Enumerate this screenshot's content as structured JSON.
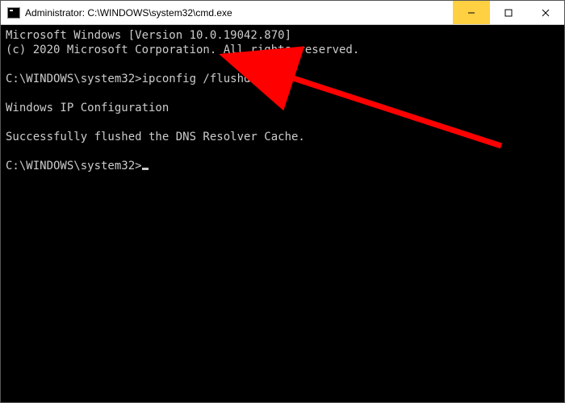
{
  "titlebar": {
    "title": "Administrator: C:\\WINDOWS\\system32\\cmd.exe"
  },
  "terminal": {
    "lines": [
      "Microsoft Windows [Version 10.0.19042.870]",
      "(c) 2020 Microsoft Corporation. All rights reserved.",
      "",
      "C:\\WINDOWS\\system32>ipconfig /flushdns",
      "",
      "Windows IP Configuration",
      "",
      "Successfully flushed the DNS Resolver Cache.",
      "",
      "C:\\WINDOWS\\system32>"
    ],
    "prompt_prefix": "C:\\WINDOWS\\system32>",
    "command": "ipconfig /flushdns"
  },
  "annotation": {
    "arrow_color": "#ff0000"
  }
}
